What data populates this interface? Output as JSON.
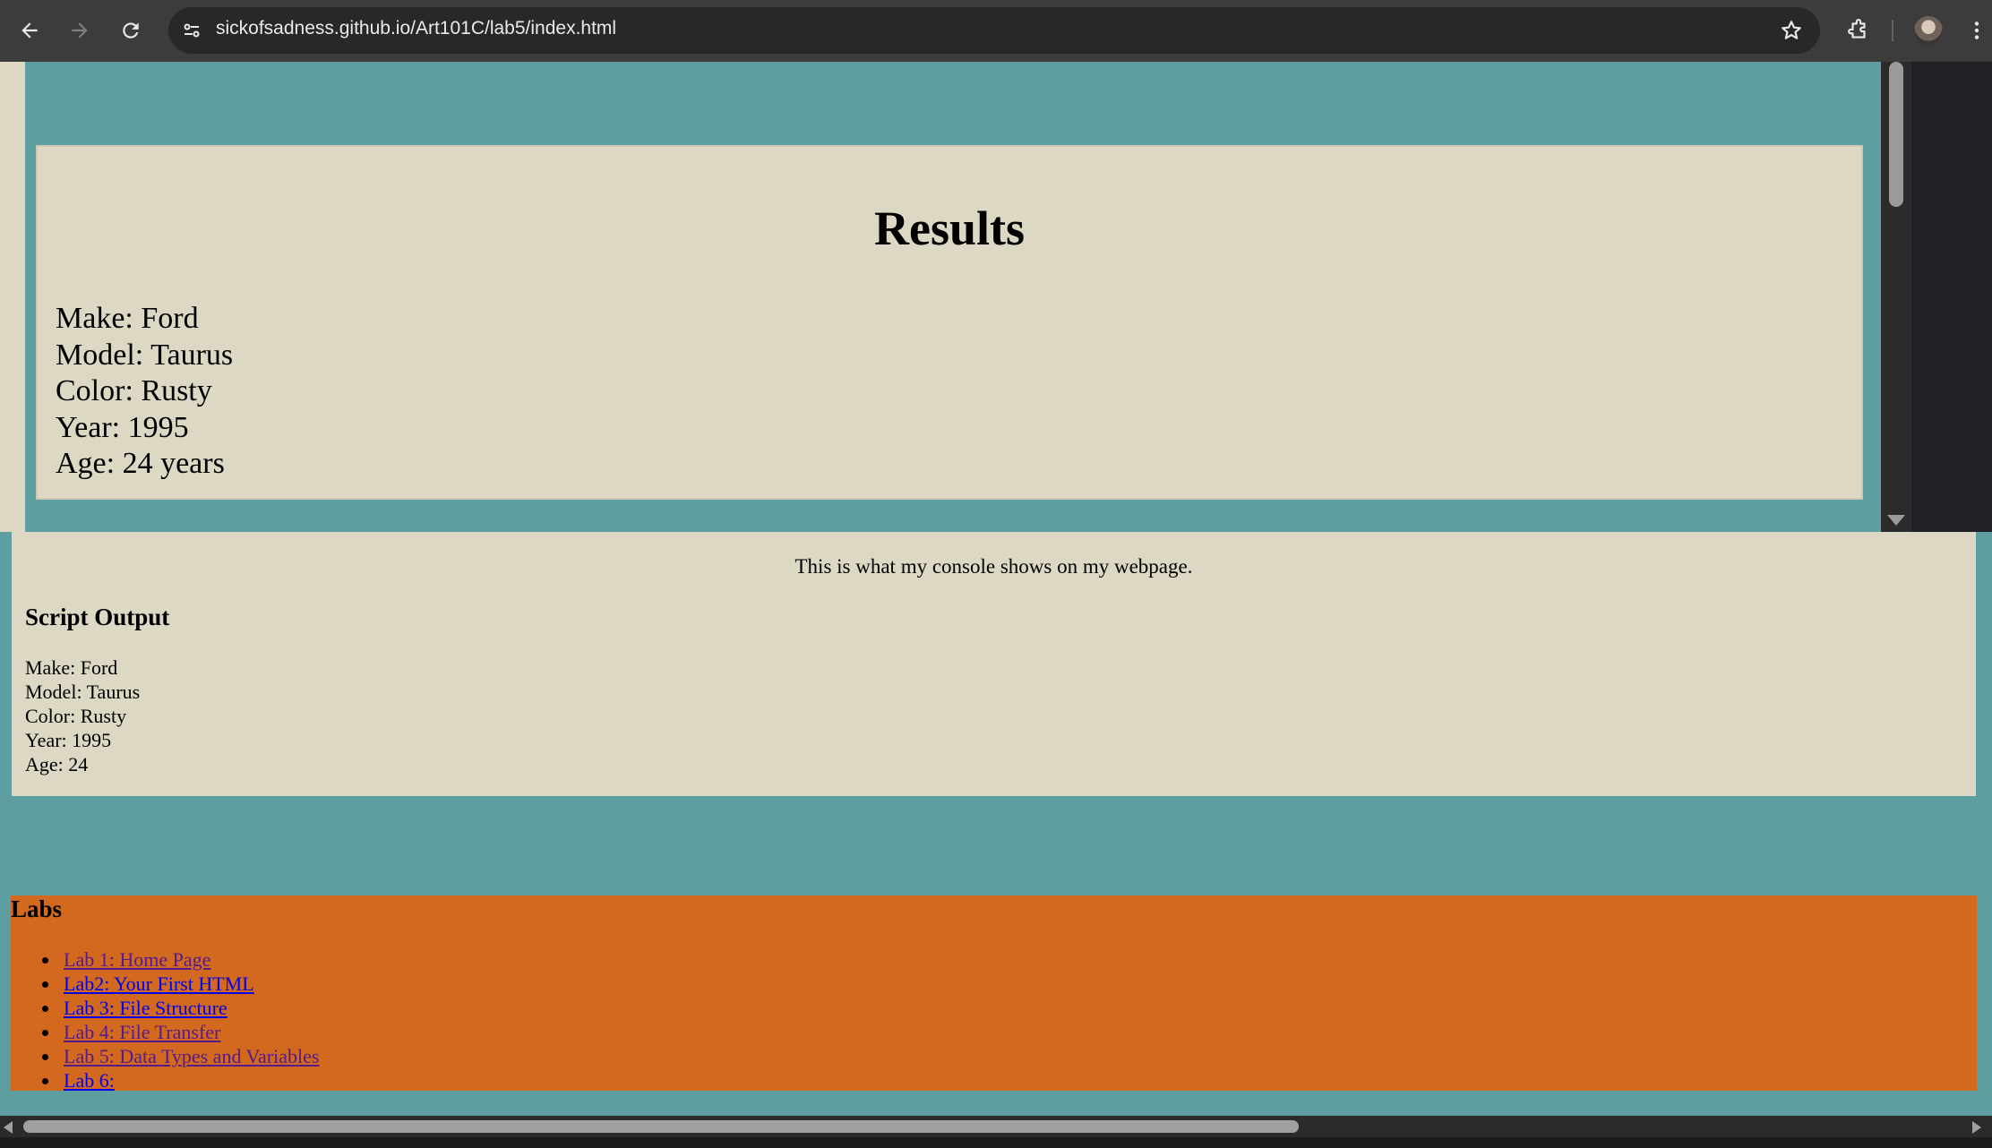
{
  "browser": {
    "url": "sickofsadness.github.io/Art101C/lab5/index.html",
    "icons": [
      "back-arrow-icon",
      "forward-arrow-icon",
      "reload-icon",
      "site-info-icon",
      "bookmark-star-icon",
      "extensions-icon",
      "profile-avatar",
      "menu-kebab-icon"
    ]
  },
  "results": {
    "title": "Results",
    "lines": [
      "Make: Ford",
      "Model: Taurus",
      "Color: Rusty",
      "Year: 1995",
      "Age: 24 years"
    ]
  },
  "console": {
    "caption": "This is what my console shows on my webpage.",
    "heading": "Script Output",
    "lines": [
      "Make: Ford",
      "Model: Taurus",
      "Color: Rusty",
      "Year: 1995",
      "Age: 24"
    ]
  },
  "labs": {
    "heading": "Labs",
    "items": [
      {
        "label": "Lab 1: Home Page",
        "visited": true
      },
      {
        "label": "Lab2: Your First HTML",
        "visited": false
      },
      {
        "label": "Lab 3: File Structure",
        "visited": false
      },
      {
        "label": "Lab 4: File Transfer",
        "visited": true
      },
      {
        "label": "Lab 5: Data Types and Variables",
        "visited": true
      },
      {
        "label": "Lab 6:",
        "visited": false
      }
    ]
  },
  "colors": {
    "page_background": "#5f9ea0",
    "content_box": "#ddd8c4",
    "labs_background": "#d2691e",
    "link_unvisited": "#0000ee",
    "link_visited": "#551a8b"
  }
}
